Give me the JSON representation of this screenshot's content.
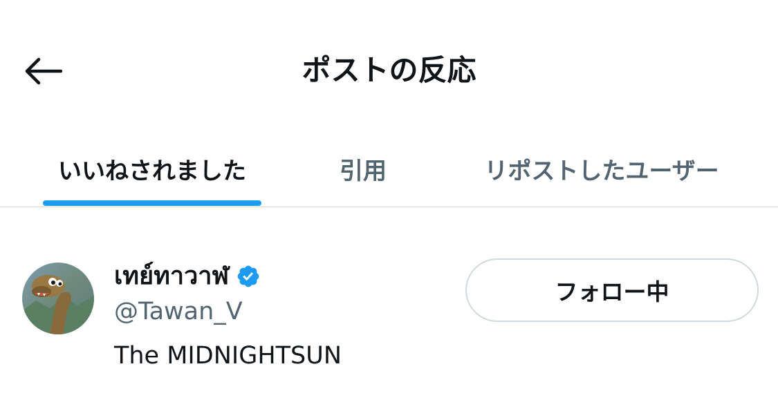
{
  "header": {
    "title": "ポストの反応",
    "back_icon": "arrow-left-icon"
  },
  "tabs": [
    {
      "label": "いいねされました",
      "active": true
    },
    {
      "label": "引用",
      "active": false
    },
    {
      "label": "リポストしたユーザー",
      "active": false
    }
  ],
  "colors": {
    "accent": "#1d9bf0",
    "text_primary": "#0f1419",
    "text_secondary": "#536471",
    "border": "#cfd9de"
  },
  "users": [
    {
      "display_name": "เทย์ทาวาฬ",
      "verified": true,
      "verified_icon": "verified-badge-icon",
      "handle": "@Tawan_V",
      "bio": "The MIDNIGHTSUN",
      "follow_button_label": "フォロー中"
    }
  ]
}
